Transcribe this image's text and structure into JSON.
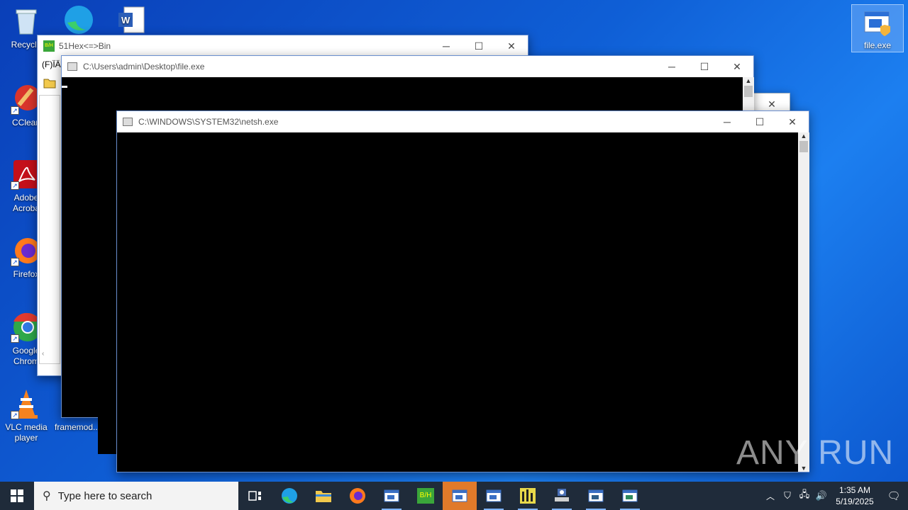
{
  "desktop": {
    "icons": [
      {
        "label": "Recycle"
      },
      {
        "label": "CClean"
      },
      {
        "label": "Adobe Acroba"
      },
      {
        "label": "Firefox"
      },
      {
        "label": "Google Chrom"
      },
      {
        "label": "VLC media player"
      },
      {
        "label": "framemod..."
      },
      {
        "label": "file.exe"
      }
    ]
  },
  "windows": {
    "hexbin": {
      "title": "51Hex<=>Bin",
      "menu": "(F)ÏÄ",
      "logo": "B/H"
    },
    "fileexe": {
      "title": "C:\\Users\\admin\\Desktop\\file.exe"
    },
    "netsh": {
      "title": "C:\\WINDOWS\\SYSTEM32\\netsh.exe"
    }
  },
  "watermark": {
    "text": "ANY RUN"
  },
  "taskbar": {
    "search_placeholder": "Type here to search",
    "time": "1:35 AM",
    "date": "5/19/2025",
    "hexbin_label": "B/H"
  },
  "colors": {
    "desktop": "#0f5fd6",
    "taskbar": "#1f2b3a",
    "active_task": "#e07a2a"
  }
}
